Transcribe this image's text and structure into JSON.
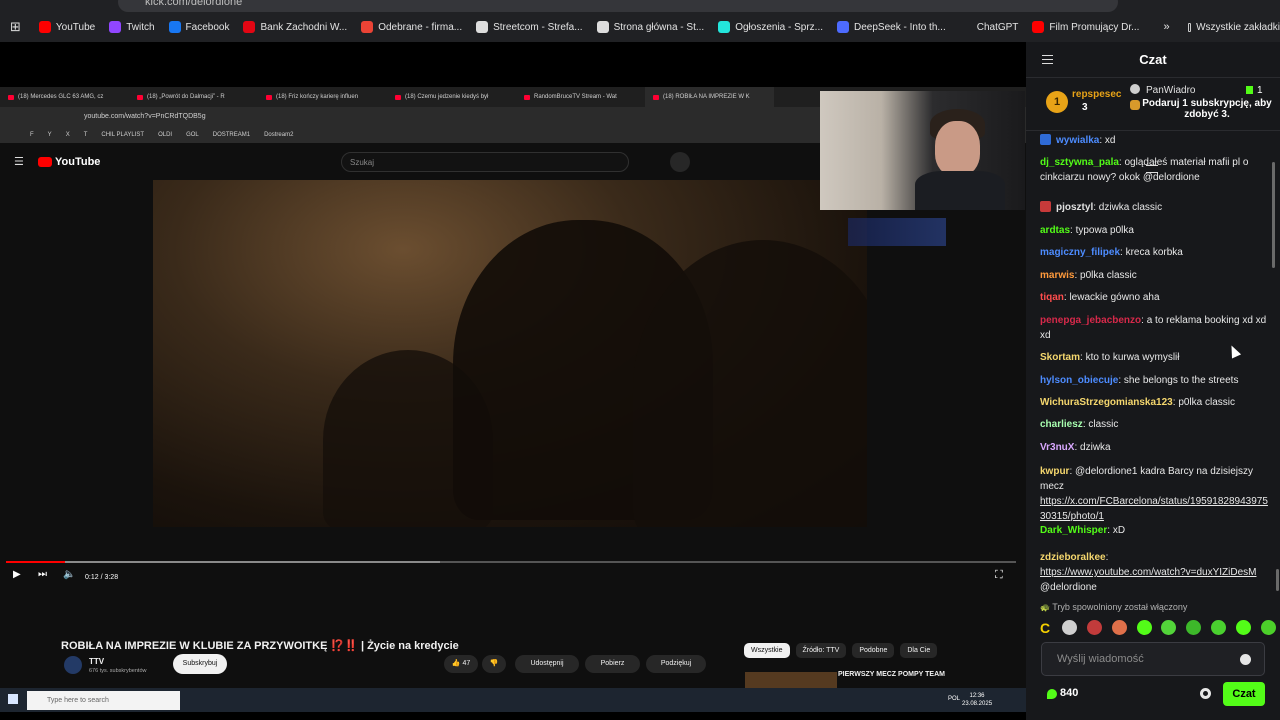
{
  "browser": {
    "url": "kick.com/delordione",
    "bookmarks": [
      {
        "label": "YouTube",
        "color": "#ff0000"
      },
      {
        "label": "Twitch",
        "color": "#9146ff"
      },
      {
        "label": "Facebook",
        "color": "#1877f2"
      },
      {
        "label": "Bank Zachodni W...",
        "color": "#e30613"
      },
      {
        "label": "Odebrane - firma...",
        "color": "#ea4335"
      },
      {
        "label": "Streetcom - Strefa...",
        "color": "#dddddd"
      },
      {
        "label": "Strona główna - St...",
        "color": "#dddddd"
      },
      {
        "label": "Ogłoszenia - Sprz...",
        "color": "#23e5db"
      },
      {
        "label": "DeepSeek - Into th...",
        "color": "#4d6bfe"
      },
      {
        "label": "ChatGPT",
        "color": "#202124"
      },
      {
        "label": "Film Promujący Dr...",
        "color": "#ff0000"
      }
    ],
    "all_bookmarks": "Wszystkie zakładki"
  },
  "inner": {
    "tabs": [
      "(18) Mercedes GLC 63 AMG, cz",
      "(18) „Powrót do Dalmacji” - R",
      "(18) Friz kończy karierę influen",
      "(18) Czemu jedzenie kiedyś był",
      "RandomBruceTV Stream - Wat",
      "(18) ROBIŁA NA IMPREZIE W K"
    ],
    "url": "youtube.com/watch?v=PnCRdTQDB5g",
    "bookmarks": [
      "F",
      "Y",
      "X",
      "T",
      "CHIL PLAYLIST",
      "OLDI",
      "GOL",
      "DOSTREAM1",
      "Dostream2"
    ],
    "yt_logo": "YouTube",
    "search_placeholder": "Szukaj",
    "time": "0:12 / 3:28",
    "progress_played": 0.058,
    "progress_buffered": 0.43,
    "video_title": "ROBIŁA NA IMPREZIE W KLUBIE ZA PRZYWOITKĘ ⁉️‼️ | Życie na kredycie",
    "channel": "TTV",
    "subscribers": "676 tys. subskrybentów",
    "subscribe": "Subskrybuj",
    "likes": "47",
    "share": "Udostępnij",
    "download": "Pobierz",
    "thanks": "Podziękuj",
    "chips": [
      "Wszystkie",
      "Źródło: TTV",
      "Podobne",
      "Dla Cie"
    ],
    "rec_title": "PIERWSZY MECZ POMPY TEAM",
    "taskbar_search": "Type here to search",
    "taskbar_lang": "POL",
    "taskbar_time": "12:36",
    "taskbar_date": "23.08.2025"
  },
  "chat": {
    "title": "Czat",
    "leader": {
      "rank": "1",
      "name": "repspesec",
      "count": "3"
    },
    "gift": {
      "user": "PanWiadro",
      "count": "1",
      "text": "Podaruj 1 subskrypcję, aby zdobyć 3."
    },
    "messages": [
      {
        "user": "wywialka",
        "text": "xd",
        "color": "#4d8cff",
        "badge": "#2f6bd6"
      },
      {
        "user": "dj_sztywna_pala",
        "text": "oglądałeś materiał mafii pl o cinkciarzu nowy? okok @delordione",
        "color": "#53fc18",
        "badge": ""
      },
      {
        "user": "pjosztyl",
        "text": "dziwka classic",
        "color": "#e0e0e0",
        "badge": "#c73a3a"
      },
      {
        "user": "ardtas",
        "text": "typowa p0lka",
        "color": "#53fc18",
        "badge": ""
      },
      {
        "user": "magiczny_filipek",
        "text": "kreca korbka",
        "color": "#4d8cff",
        "badge": ""
      },
      {
        "user": "marwis",
        "text": "p0lka classic",
        "color": "#ff9a3c",
        "badge": ""
      },
      {
        "user": "tiqan",
        "text": "lewackie gówno aha",
        "color": "#ff4d4d",
        "badge": ""
      },
      {
        "user": "penepga_jebacbenzo",
        "text": "a to reklama booking xd xd xd",
        "color": "#d6294a",
        "badge": ""
      },
      {
        "user": "Skortam",
        "text": "kto to kurwa wymyslił",
        "color": "#f5d76e",
        "badge": ""
      },
      {
        "user": "hylson_obiecuje",
        "text": "she belongs to the streets",
        "color": "#4d8cff",
        "badge": ""
      },
      {
        "user": "WichuraStrzegomianska123",
        "text": "p0lka classic",
        "color": "#f5d76e",
        "badge": ""
      },
      {
        "user": "charliesz",
        "text": "classic",
        "color": "#a8ffb0",
        "badge": ""
      },
      {
        "user": "Vr3nuX",
        "text": "dziwka",
        "color": "#d9a8ff",
        "badge": ""
      },
      {
        "user": "kwpur",
        "text": "@delordione1 kadra Barcy na dzisiejszy mecz",
        "link": "https://x.com/FCBarcelona/status/1959182894397530315/photo/1",
        "color": "#f5d76e",
        "badge": ""
      },
      {
        "user": "Dark_Whisper",
        "text": "xD",
        "color": "#53fc18",
        "badge": ""
      },
      {
        "user": "zdzieboralkee",
        "text": "",
        "link": "https://www.youtube.com/watch?v=duxYIZiDesM",
        "after": " @delordione",
        "color": "#f5d76e",
        "badge": ""
      }
    ],
    "slowmode": "Tryb spowolniony został włączony",
    "emote_prefix": "C",
    "input_placeholder": "Wyślij wiadomość",
    "points": "840",
    "send": "Czat"
  }
}
